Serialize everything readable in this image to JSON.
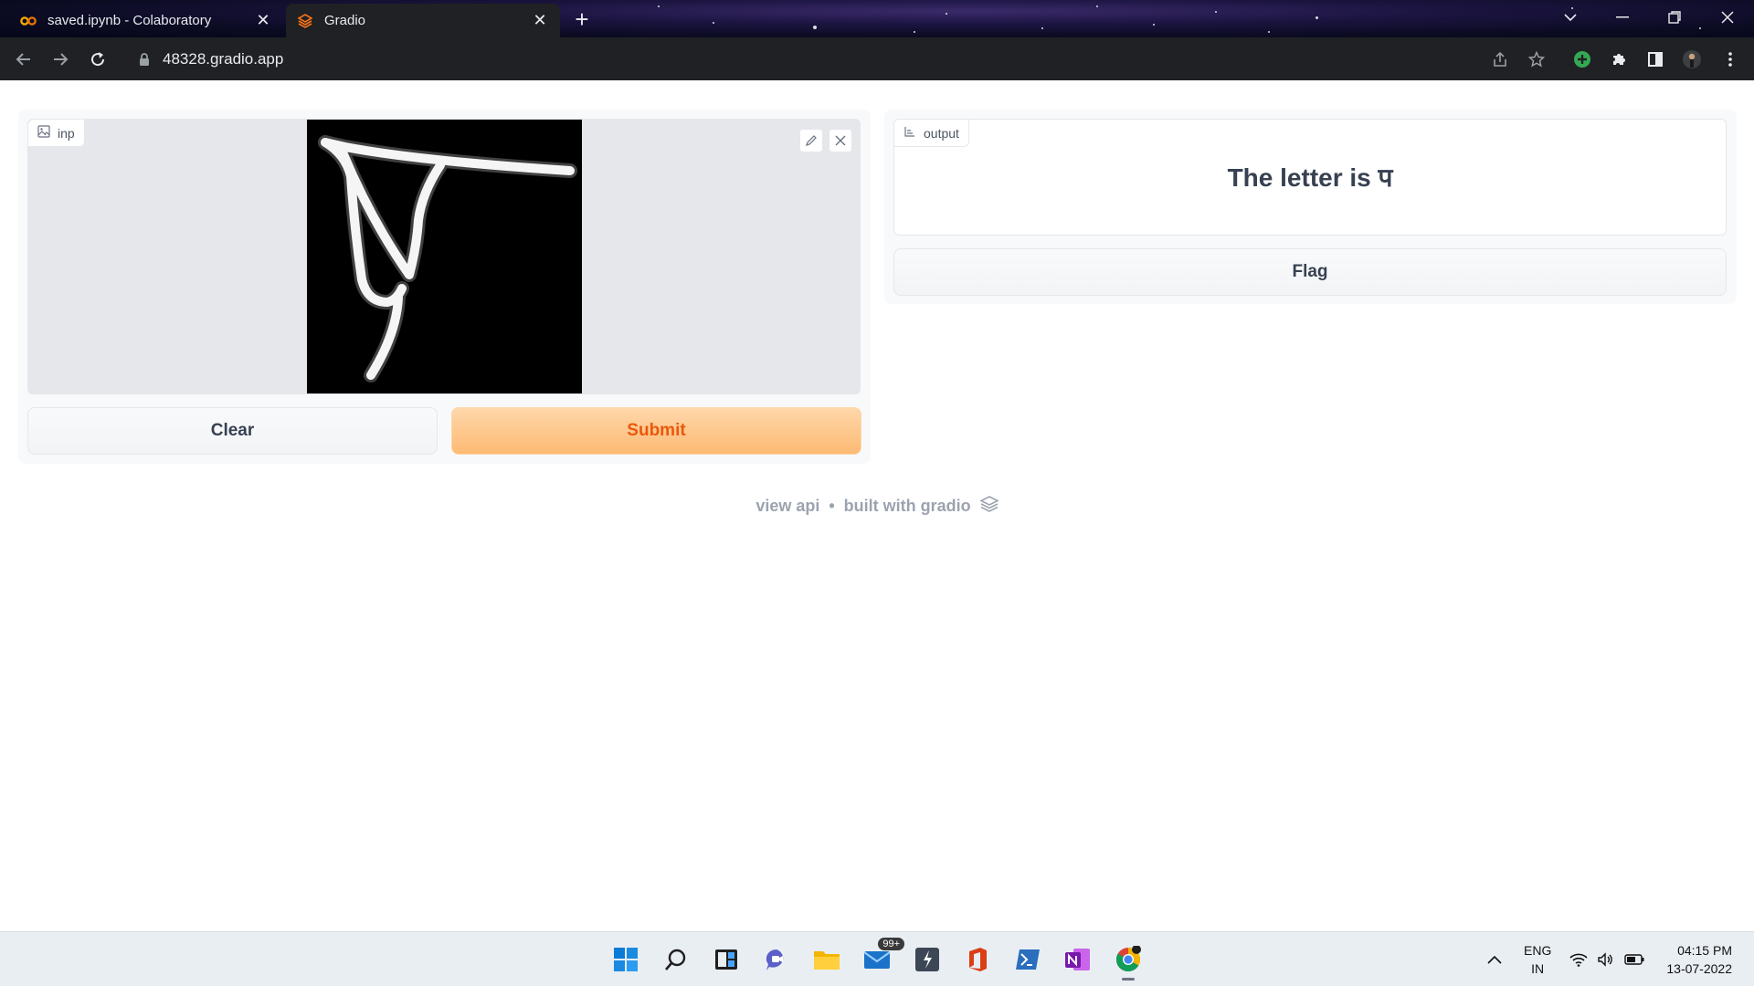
{
  "browser": {
    "tabs": [
      {
        "title": "saved.ipynb - Colaboratory",
        "icon": "colab-icon",
        "active": false
      },
      {
        "title": "Gradio",
        "icon": "gradio-icon",
        "active": true
      }
    ],
    "url": "48328.gradio.app"
  },
  "app": {
    "input_label": "inp",
    "output_label": "output",
    "output_text": "The letter is प",
    "clear_label": "Clear",
    "submit_label": "Submit",
    "flag_label": "Flag",
    "footer_api": "view api",
    "footer_sep": "•",
    "footer_built": "built with gradio",
    "accent_color": "#ea580c"
  },
  "taskbar": {
    "mail_badge": "99+",
    "lang_1": "ENG",
    "lang_2": "IN",
    "time": "04:15 PM",
    "date": "13-07-2022"
  }
}
